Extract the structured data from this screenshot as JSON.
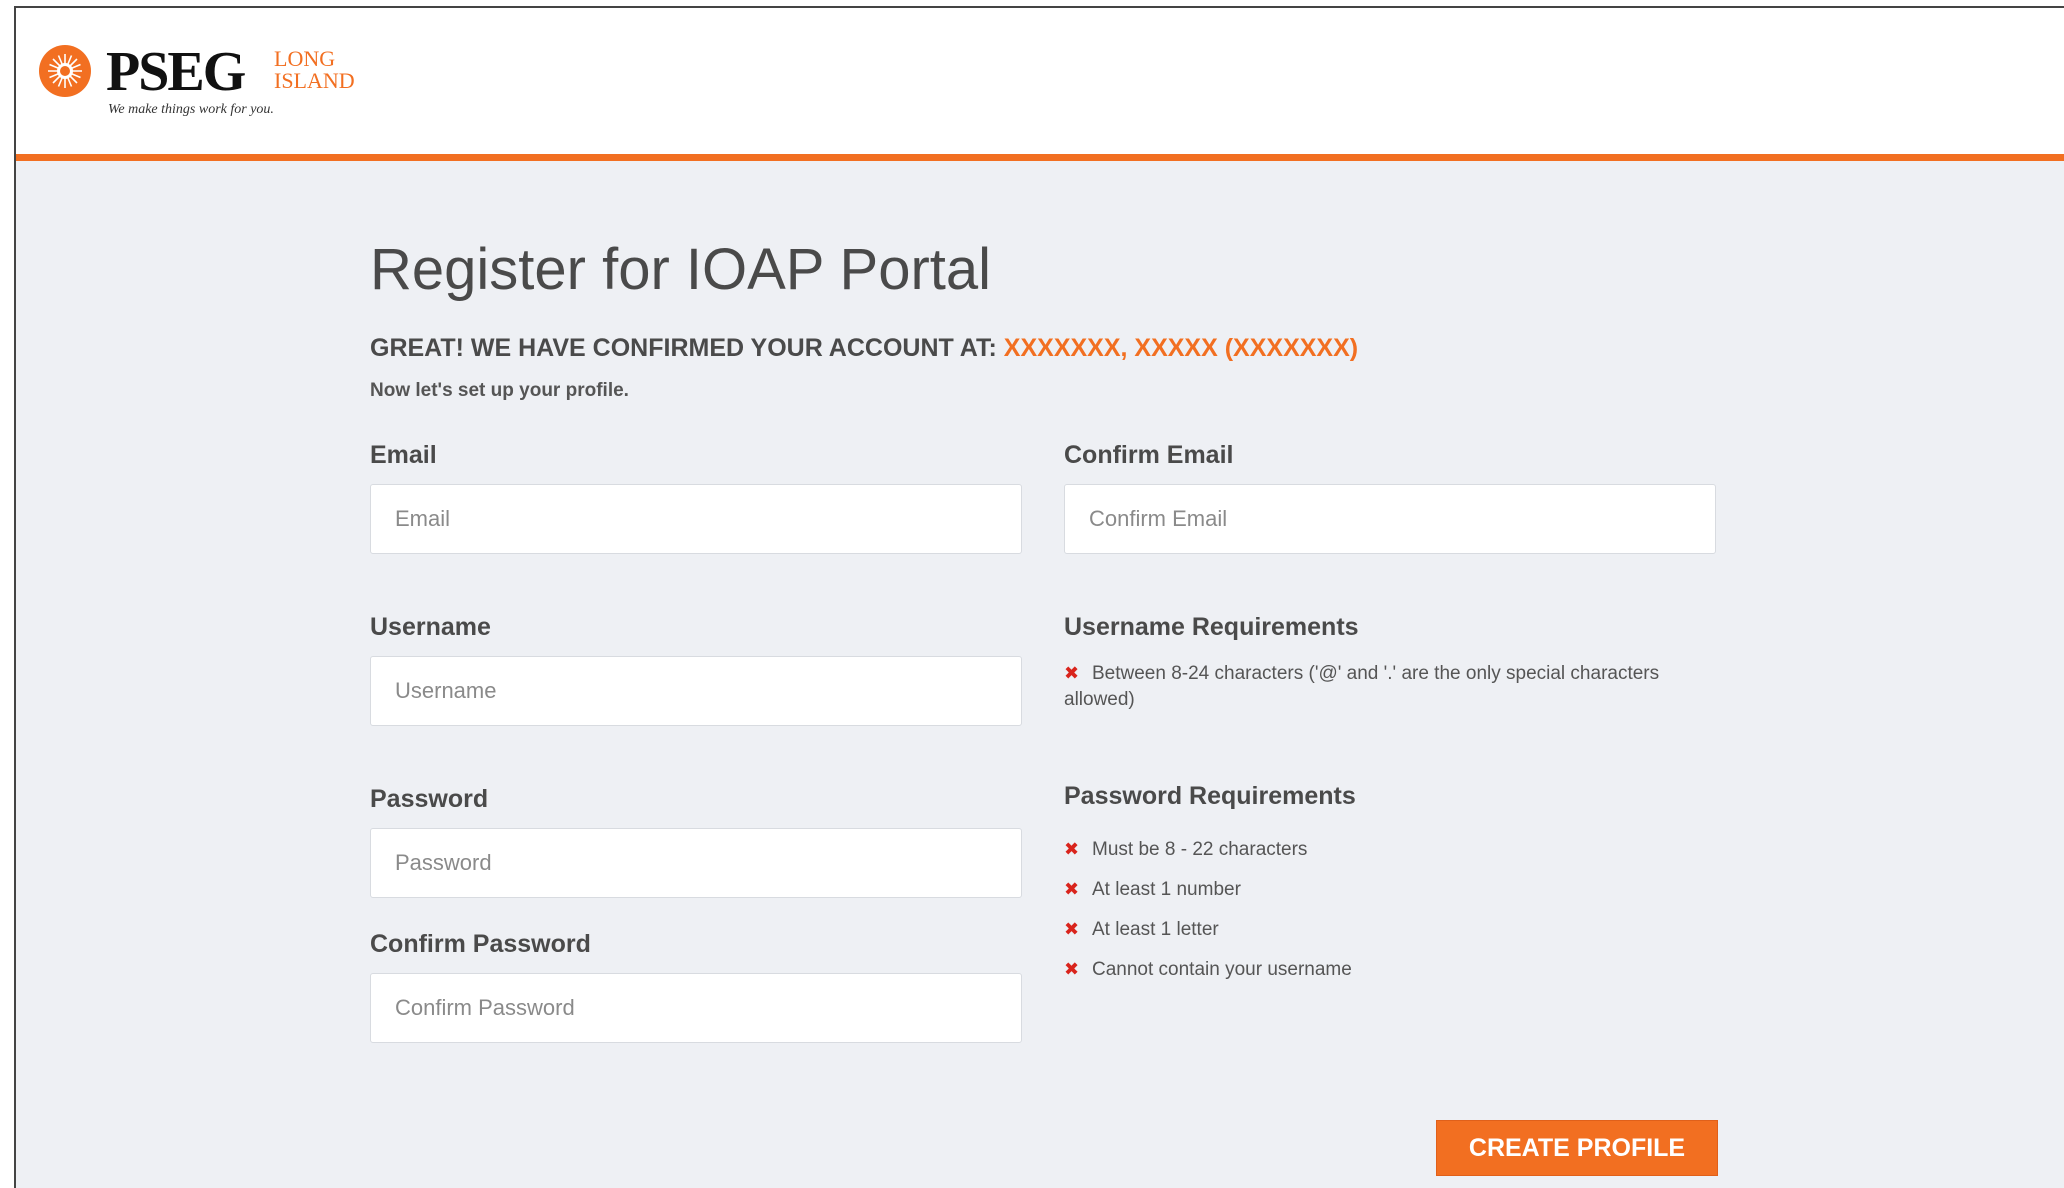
{
  "brand": {
    "name": "PSEG",
    "region_line1": "LONG",
    "region_line2": "ISLAND",
    "tagline": "We make things work for you.",
    "accent_color": "#f26f21",
    "logo_icon": "sunburst-logo-icon"
  },
  "page": {
    "title": "Register for IOAP Portal",
    "confirm_prefix": "GREAT! WE HAVE CONFIRMED YOUR ACCOUNT AT:",
    "confirm_account": "XXXXXXX, XXXXX (XXXXXXX)",
    "subtext": "Now let's set up your profile."
  },
  "form": {
    "email": {
      "label": "Email",
      "placeholder": "Email",
      "value": ""
    },
    "confirm_email": {
      "label": "Confirm Email",
      "placeholder": "Confirm Email",
      "value": ""
    },
    "username": {
      "label": "Username",
      "placeholder": "Username",
      "value": ""
    },
    "password": {
      "label": "Password",
      "placeholder": "Password",
      "value": ""
    },
    "confirm_password": {
      "label": "Confirm Password",
      "placeholder": "Confirm Password",
      "value": ""
    }
  },
  "username_requirements": {
    "title": "Username Requirements",
    "items": [
      "Between 8-24 characters ('@' and '.' are the only special characters allowed)"
    ]
  },
  "password_requirements": {
    "title": "Password Requirements",
    "items": [
      "Must be 8 - 22 characters",
      "At least 1 number",
      "At least 1 letter",
      "Cannot contain your username"
    ]
  },
  "status_icon": "x-mark-icon",
  "status_color": "#d9241c",
  "create_button": {
    "label": "CREATE PROFILE"
  }
}
